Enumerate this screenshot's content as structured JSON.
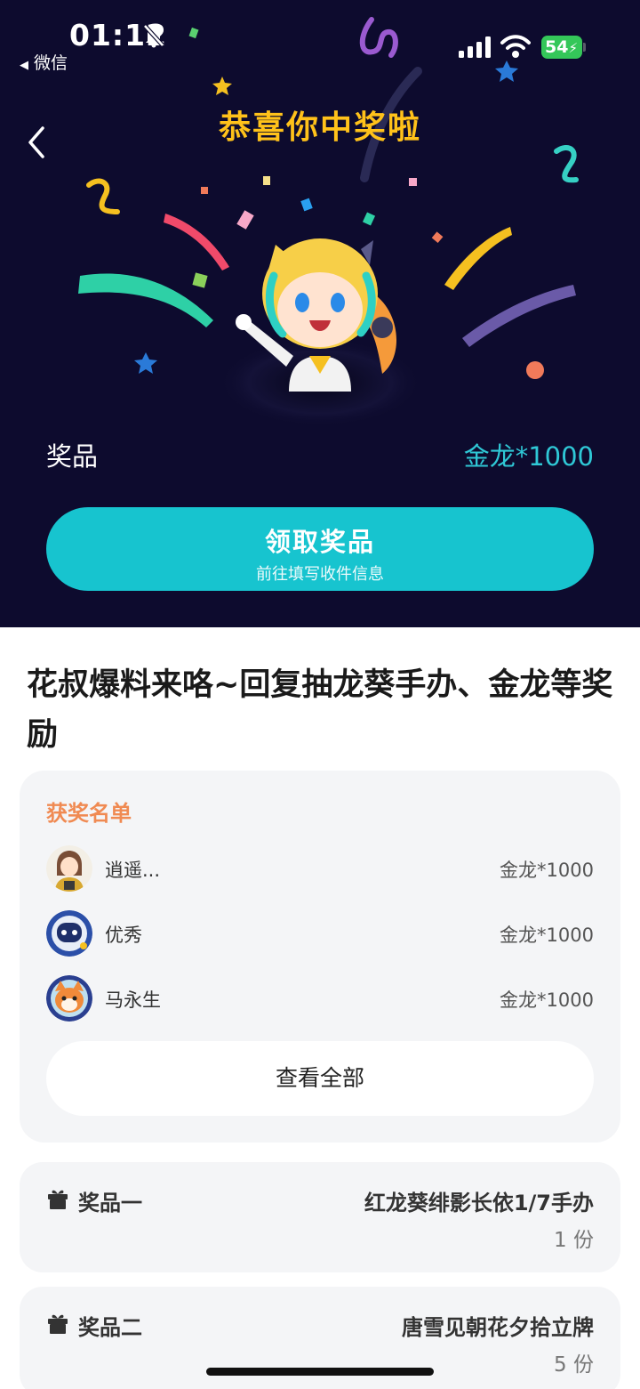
{
  "status_bar": {
    "time": "01:12",
    "back_app": "微信",
    "battery": "54"
  },
  "hero": {
    "title": "恭喜你中奖啦",
    "prize_label": "奖品",
    "prize_value": "金龙*1000",
    "claim_button": {
      "label": "领取奖品",
      "sublabel": "前往填写收件信息"
    },
    "colors": {
      "background": "#0d0b2e",
      "title": "#ffc21a",
      "accent": "#17c4cf"
    }
  },
  "event": {
    "title": "花叔爆料来咯~回复抽龙葵手办、金龙等奖励"
  },
  "winners": {
    "title": "获奖名单",
    "items": [
      {
        "name": "逍遥...",
        "prize": "金龙*1000"
      },
      {
        "name": "优秀",
        "prize": "金龙*1000"
      },
      {
        "name": "马永生",
        "prize": "金龙*1000"
      }
    ],
    "view_all": "查看全部"
  },
  "prizes": [
    {
      "tier": "奖品一",
      "name": "红龙葵绯影长依1/7手办",
      "qty": "1 份"
    },
    {
      "tier": "奖品二",
      "name": "唐雪见朝花夕拾立牌",
      "qty": "5 份"
    }
  ]
}
